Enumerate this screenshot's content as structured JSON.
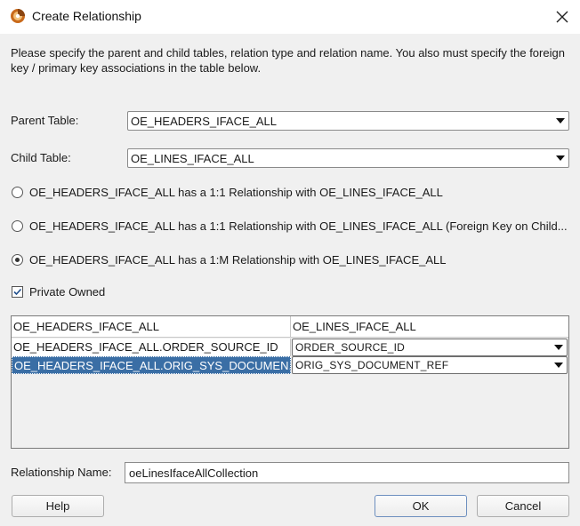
{
  "window": {
    "title": "Create Relationship",
    "icon": "relationship-app-icon",
    "close_icon": "close-icon"
  },
  "description": "Please specify the parent and child tables, relation type and relation name.  You also must specify the foreign key / primary key associations in the table below.",
  "parent_table": {
    "label": "Parent Table:",
    "value": "OE_HEADERS_IFACE_ALL"
  },
  "child_table": {
    "label": "Child Table:",
    "value": "OE_LINES_IFACE_ALL"
  },
  "relationship_options": [
    {
      "label": "OE_HEADERS_IFACE_ALL has a 1:1 Relationship with OE_LINES_IFACE_ALL",
      "selected": false
    },
    {
      "label": "OE_HEADERS_IFACE_ALL has a 1:1 Relationship with OE_LINES_IFACE_ALL (Foreign Key on Child...",
      "selected": false
    },
    {
      "label": "OE_HEADERS_IFACE_ALL has a 1:M Relationship with OE_LINES_IFACE_ALL",
      "selected": true
    }
  ],
  "private_owned": {
    "label": "Private Owned",
    "checked": true
  },
  "key_table": {
    "columns": [
      "OE_HEADERS_IFACE_ALL",
      "OE_LINES_IFACE_ALL"
    ],
    "rows": [
      {
        "parent": "OE_HEADERS_IFACE_ALL.ORDER_SOURCE_ID",
        "child": "ORDER_SOURCE_ID",
        "selected": false
      },
      {
        "parent": "OE_HEADERS_IFACE_ALL.ORIG_SYS_DOCUMEN...",
        "child": "ORIG_SYS_DOCUMENT_REF",
        "selected": true
      }
    ]
  },
  "relationship_name": {
    "label": "Relationship Name:",
    "value": "oeLinesIfaceAllCollection"
  },
  "buttons": {
    "help": "Help",
    "ok": "OK",
    "cancel": "Cancel"
  },
  "colors": {
    "selection": "#3a6ea5",
    "dialog_bg": "#f0f0f0"
  }
}
